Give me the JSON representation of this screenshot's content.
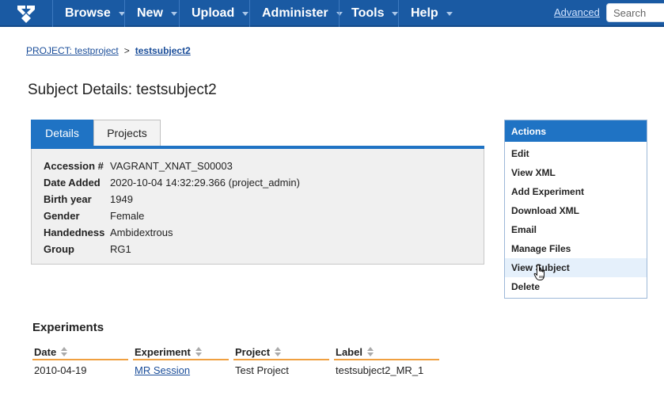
{
  "nav": {
    "items": [
      "Browse",
      "New",
      "Upload",
      "Administer",
      "Tools",
      "Help"
    ],
    "advanced_label": "Advanced",
    "search_placeholder": "Search"
  },
  "breadcrumb": {
    "project": "PROJECT: testproject",
    "separator": ">",
    "current": "testsubject2"
  },
  "page_title": "Subject Details: testsubject2",
  "tabs": [
    "Details",
    "Projects"
  ],
  "details": [
    {
      "label": "Accession #",
      "value": "VAGRANT_XNAT_S00003"
    },
    {
      "label": "Date Added",
      "value": "2020-10-04 14:32:29.366 (project_admin)"
    },
    {
      "label": "Birth year",
      "value": "1949"
    },
    {
      "label": "Gender",
      "value": "Female"
    },
    {
      "label": "Handedness",
      "value": "Ambidextrous"
    },
    {
      "label": "Group",
      "value": "RG1"
    }
  ],
  "actions": {
    "title": "Actions",
    "items": [
      "Edit",
      "View XML",
      "Add Experiment",
      "Download XML",
      "Email",
      "Manage Files",
      "View Subject",
      "Delete"
    ]
  },
  "experiments": {
    "title": "Experiments",
    "columns": [
      "Date",
      "Experiment",
      "Project",
      "Label"
    ],
    "rows": [
      {
        "date": "2010-04-19",
        "experiment": "MR Session",
        "project": "Test Project",
        "label": "testsubject2_MR_1"
      }
    ]
  },
  "colors": {
    "nav_bg": "#1a5aa3",
    "accent_blue": "#1f73c4",
    "table_header_rule": "#f0a040",
    "link": "#1a4d99"
  }
}
